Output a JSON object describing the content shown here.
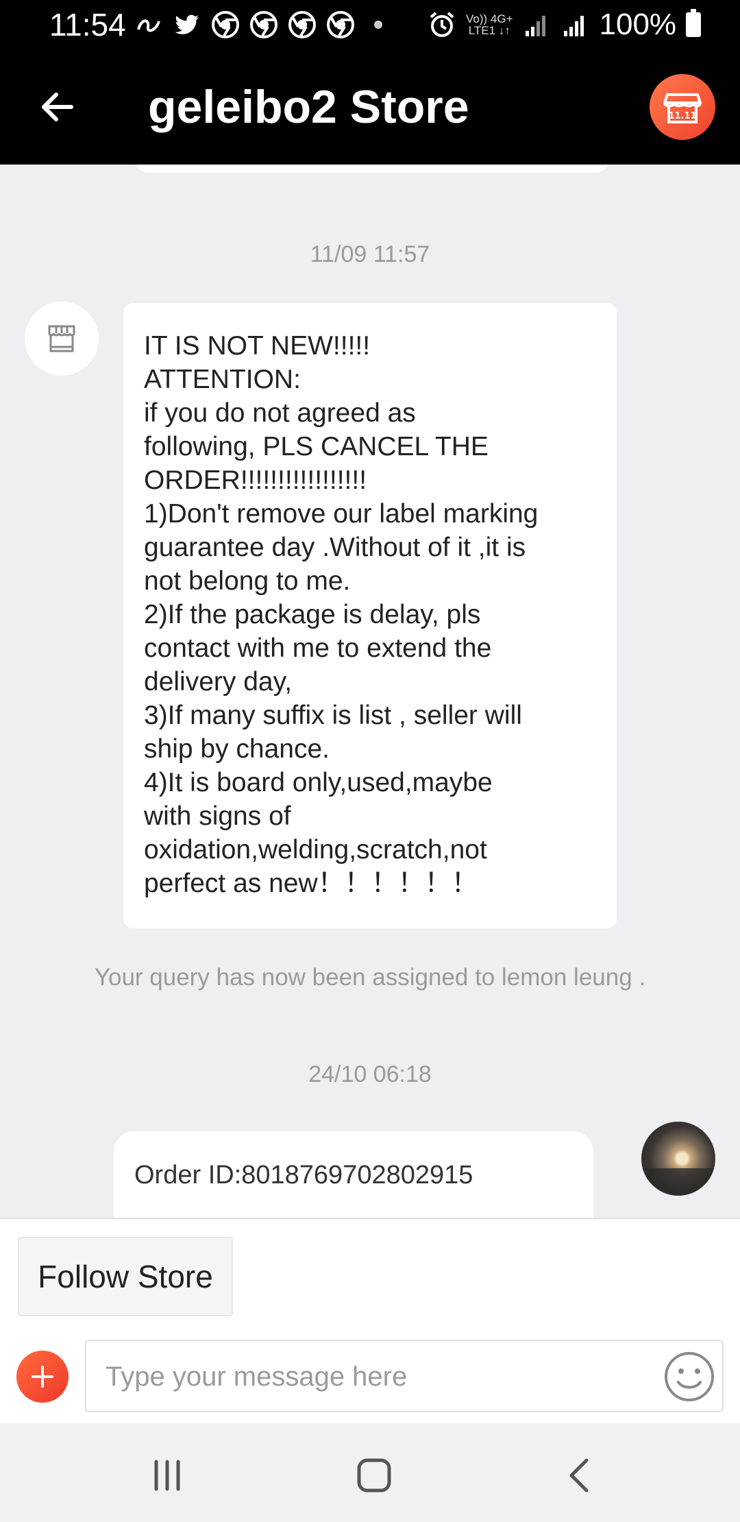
{
  "status_bar": {
    "time": "11:54",
    "network_label_top": "Vo)) 4G+",
    "network_label_bottom": "LTE1 ↓↑",
    "battery": "100%"
  },
  "header": {
    "title": "geleibo2 Store",
    "back_icon": "arrow-left-icon",
    "store_icon": "storefront-icon"
  },
  "chat": {
    "timestamp_1": "11/09 11:57",
    "message_lines": [
      "IT IS NOT NEW!!!!!",
      "ATTENTION:",
      "if you do not agreed as",
      "following, PLS CANCEL THE",
      "ORDER!!!!!!!!!!!!!!!!!",
      "1)Don't remove our label marking",
      "guarantee day .Without of it ,it is",
      "not belong to me.",
      "2)If the package is delay, pls",
      "contact with me to extend the",
      "delivery day,",
      "3)If many suffix is list , seller will",
      "ship by chance.",
      "4)It is board only,used,maybe",
      "with signs of",
      "oxidation,welding,scratch,not",
      "perfect as new！！！！！！"
    ],
    "system_message": "Your query has now been assigned to lemon leung .",
    "timestamp_2": "24/10 06:18",
    "order_message": "Order ID:8018769702802915"
  },
  "bottom": {
    "follow_label": "Follow Store",
    "input_placeholder": "Type your message here",
    "input_value": ""
  },
  "colors": {
    "accent": "#f0412b",
    "header_bg": "#000000",
    "chat_bg": "#efeff1"
  }
}
